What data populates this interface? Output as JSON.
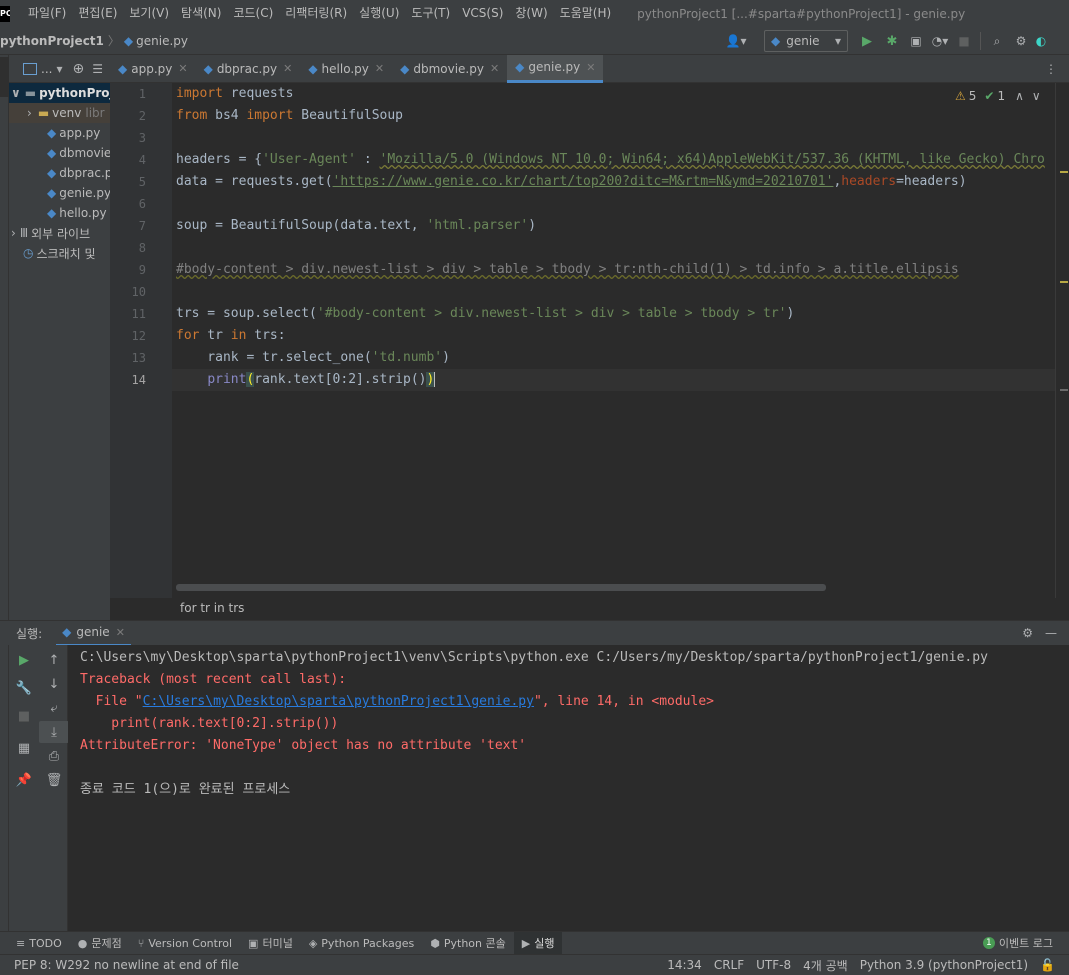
{
  "menubar": {
    "logo": "PC",
    "items": [
      "파일(F)",
      "편집(E)",
      "보기(V)",
      "탐색(N)",
      "코드(C)",
      "리팩터링(R)",
      "실행(U)",
      "도구(T)",
      "VCS(S)",
      "창(W)",
      "도움말(H)"
    ],
    "title": "pythonProject1 [...#sparta#pythonProject1] - genie.py"
  },
  "navbar": {
    "project": "pythonProject1",
    "file": "genie.py",
    "run_config": "genie"
  },
  "project_panel": {
    "dropdown": "...",
    "root": "pythonProje",
    "venv": "venv",
    "venv_hint": "libr",
    "files": [
      "app.py",
      "dbmovie",
      "dbprac.py",
      "genie.py",
      "hello.py"
    ],
    "external": "외부 라이브",
    "scratch": "스크래치 및"
  },
  "tabs": [
    {
      "label": "app.py",
      "active": false
    },
    {
      "label": "dbprac.py",
      "active": false
    },
    {
      "label": "hello.py",
      "active": false
    },
    {
      "label": "dbmovie.py",
      "active": false
    },
    {
      "label": "genie.py",
      "active": true
    }
  ],
  "editor": {
    "warnings": "5",
    "ok_count": "1",
    "line_numbers": [
      "1",
      "2",
      "3",
      "4",
      "5",
      "6",
      "7",
      "8",
      "9",
      "10",
      "11",
      "12",
      "13",
      "14"
    ],
    "current_line": 14,
    "breadcrumb": "for tr in trs"
  },
  "code": {
    "l1_kw": "import",
    "l1_rest": " requests",
    "l2_kw1": "from",
    "l2_mid": " bs4 ",
    "l2_kw2": "import",
    "l2_rest": " BeautifulSoup",
    "l4_a": "headers = {",
    "l4_s1": "'User-Agent'",
    "l4_b": " : ",
    "l4_s2": "'Mozilla/5.0 (Windows NT 10.0; Win64; x64)AppleWebKit/537.36 (KHTML, like Gecko) Chro",
    "l5_a": "data = requests.get(",
    "l5_s": "'https://www.genie.co.kr/chart/top200?ditc=M&rtm=N&ymd=20210701'",
    "l5_b": ",",
    "l5_p": "headers",
    "l5_c": "=headers)",
    "l7_a": "soup = BeautifulSoup(data.text, ",
    "l7_s": "'html.parser'",
    "l7_b": ")",
    "l9_c": "#body-content > div.newest-list > div > table > tbody > tr:nth-child(1) > td.info > a.title.ellipsis",
    "l11_a": "trs = soup.select(",
    "l11_s": "'#body-content > div.newest-list > div > table > tbody > tr'",
    "l11_b": ")",
    "l12_kw1": "for",
    "l12_mid": " tr ",
    "l12_kw2": "in",
    "l12_rest": " trs:",
    "l13_a": "    rank = tr.select_one(",
    "l13_s": "'td.numb'",
    "l13_b": ")",
    "l14_indent": "    ",
    "l14_fn": "print",
    "l14_p1": "(",
    "l14_mid": "rank.text[0:2].strip()",
    "l14_p2": ")"
  },
  "run": {
    "label": "실행:",
    "tab": "genie",
    "cmd": "C:\\Users\\my\\Desktop\\sparta\\pythonProject1\\venv\\Scripts\\python.exe C:/Users/my/Desktop/sparta/pythonProject1/genie.py",
    "traceback": "Traceback (most recent call last):",
    "file_pre": "  File \"",
    "file_link": "C:\\Users\\my\\Desktop\\sparta\\pythonProject1\\genie.py",
    "file_post": "\", line 14, in <module>",
    "err_line": "    print(rank.text[0:2].strip())",
    "error": "AttributeError: 'NoneType' object has no attribute 'text'",
    "exit": "종료 코드 1(으)로 완료된 프로세스"
  },
  "bottom_tools": [
    "TODO",
    "문제점",
    "Version Control",
    "터미널",
    "Python Packages",
    "Python 콘솔",
    "실행"
  ],
  "event_log": {
    "count": "1",
    "label": "이벤트 로그"
  },
  "status": {
    "message": "PEP 8: W292 no newline at end of file",
    "position": "14:34",
    "line_sep": "CRLF",
    "encoding": "UTF-8",
    "indent": "4개 공백",
    "interpreter": "Python 3.9 (pythonProject1)"
  },
  "colors": {
    "accent": "#4a88c7",
    "error": "#ff6b68",
    "run_green": "#59a869"
  }
}
